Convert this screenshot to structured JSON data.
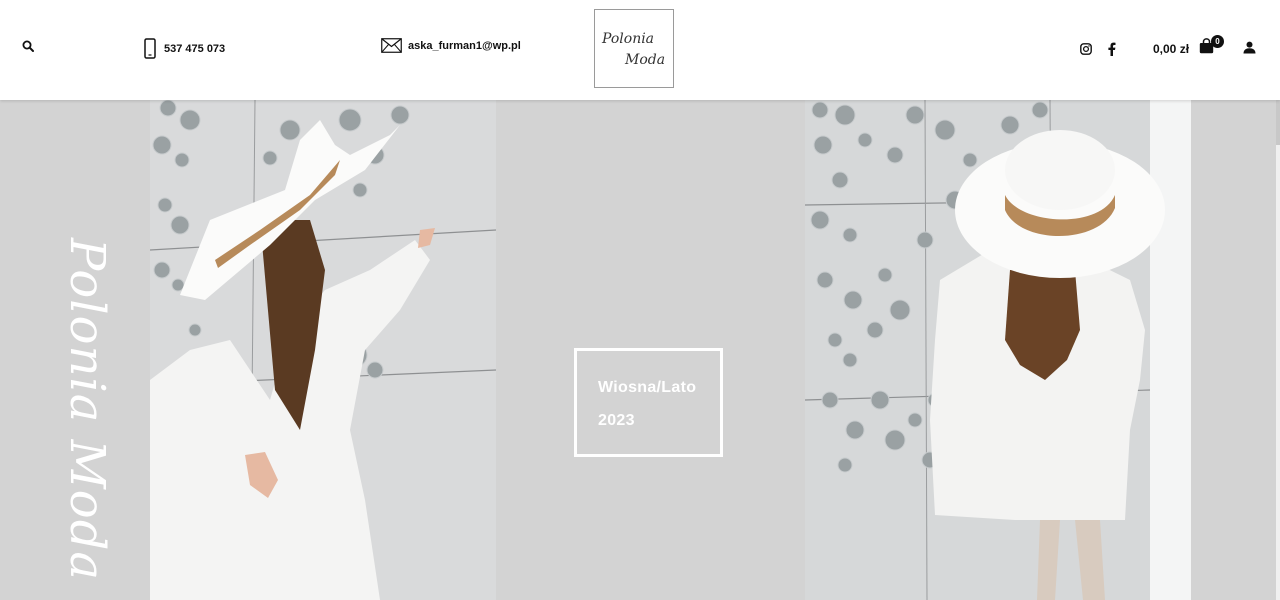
{
  "header": {
    "phone": "537 475 073",
    "email": "aska_furman1@wp.pl",
    "logo_line1": "Polonia",
    "logo_line2": "Moda",
    "cart_total": "0,00 zł",
    "cart_count": "0",
    "icons": {
      "search": "search-icon",
      "phone": "phone-icon",
      "email": "envelope-icon",
      "instagram": "instagram-icon",
      "facebook": "facebook-icon",
      "cart": "shopping-bag-icon",
      "account": "user-icon"
    }
  },
  "hero": {
    "vertical_brand": "Polonia Moda",
    "season_line1": "Wiosna/Lato",
    "season_line2": "2023"
  },
  "colors": {
    "page_background": "#d3d3d3",
    "header_background": "#ffffff",
    "text": "#111111",
    "box_border": "#ffffff"
  }
}
